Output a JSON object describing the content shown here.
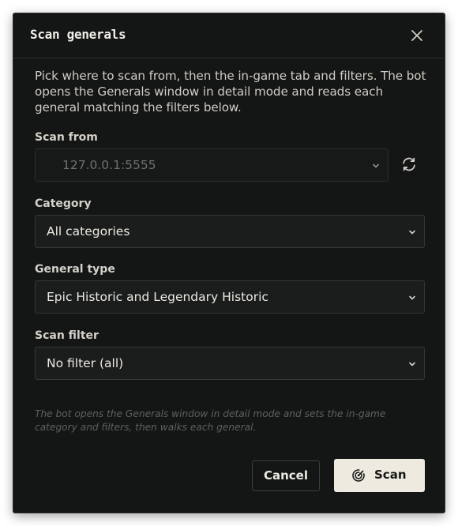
{
  "dialog": {
    "title": "Scan generals",
    "intro": "Pick where to scan from, then the in-game tab and filters. The bot opens the Generals window in detail mode and reads each general matching the filters below."
  },
  "scan_from": {
    "label": "Scan from",
    "value": "127.0.0.1:5555"
  },
  "category": {
    "label": "Category",
    "value": "All categories"
  },
  "general_type": {
    "label": "General type",
    "value": "Epic Historic and Legendary Historic"
  },
  "scan_filter": {
    "label": "Scan filter",
    "value": "No filter (all)"
  },
  "footnote": "The bot opens the Generals window in detail mode and sets the in-game category and filters, then walks each general.",
  "buttons": {
    "cancel": "Cancel",
    "scan": "Scan"
  },
  "icons": {
    "close": "close-icon",
    "refresh": "refresh-icon",
    "chevron": "chevron-down-icon",
    "radar": "radar-icon"
  },
  "colors": {
    "background": "#141615",
    "scan_button": "#eeeae0",
    "text": "#e6e3dc"
  }
}
